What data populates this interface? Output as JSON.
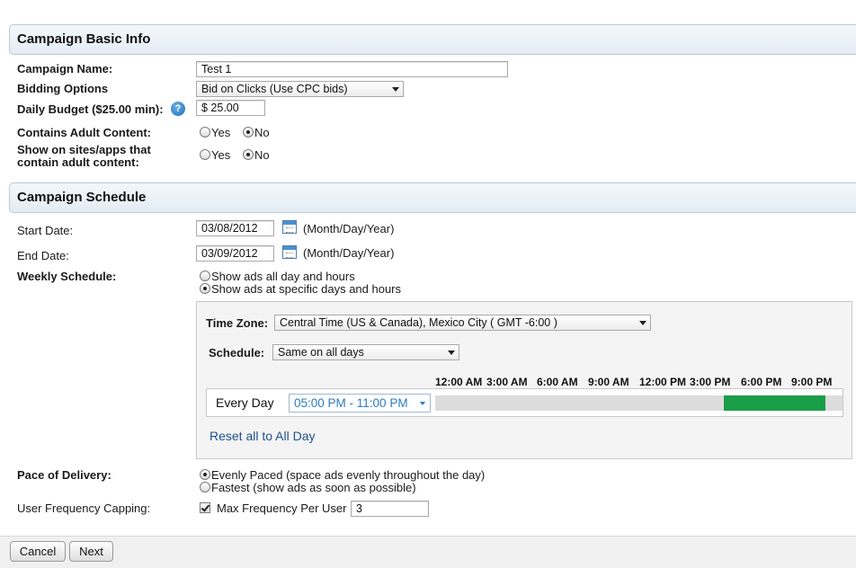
{
  "basic_info": {
    "title": "Campaign Basic Info",
    "campaign_name_label": "Campaign Name:",
    "campaign_name_value": "Test 1",
    "bidding_label": "Bidding Options",
    "bidding_value": "Bid on Clicks (Use CPC bids)",
    "budget_label": "Daily Budget ($25.00 min):",
    "budget_value": "$ 25.00",
    "help_glyph": "?",
    "adult_label": "Contains Adult Content:",
    "adult_options": [
      "Yes",
      "No"
    ],
    "adult_selected": "No",
    "sites_label_line1": "Show on sites/apps that",
    "sites_label_line2": "contain adult content:",
    "sites_options": [
      "Yes",
      "No"
    ],
    "sites_selected": "No"
  },
  "schedule": {
    "title": "Campaign Schedule",
    "start_label": "Start Date:",
    "start_value": "03/08/2012",
    "end_label": "End Date:",
    "end_value": "03/09/2012",
    "date_format": "(Month/Day/Year)",
    "weekly_label": "Weekly Schedule:",
    "weekly_options": [
      "Show ads all day and hours",
      "Show ads at specific days and hours"
    ],
    "weekly_selected": "Show ads at specific days and hours",
    "timezone_label": "Time Zone:",
    "timezone_value": "Central Time (US & Canada), Mexico City ( GMT -6:00 )",
    "schedule_label": "Schedule:",
    "schedule_value": "Same on all days",
    "hours": [
      "12:00 AM",
      "3:00 AM",
      "6:00 AM",
      "9:00 AM",
      "12:00 PM",
      "3:00 PM",
      "6:00 PM",
      "9:00 PM"
    ],
    "row_label": "Every Day",
    "row_range": "05:00 PM - 11:00 PM",
    "active_start_hour": 17,
    "active_end_hour": 23,
    "reset_link": "Reset all to All Day",
    "active_color": "#1a9e47"
  },
  "delivery": {
    "pace_label": "Pace of Delivery:",
    "pace_options": [
      "Evenly Paced (space ads evenly throughout the day)",
      "Fastest (show ads as soon as possible)"
    ],
    "pace_selected": "Evenly Paced (space ads evenly throughout the day)",
    "freq_label": "User Frequency Capping:",
    "freq_checkbox_label": "Max Frequency Per User",
    "freq_checked": true,
    "freq_value": "3"
  },
  "footer": {
    "cancel_label": "Cancel",
    "next_label": "Next"
  }
}
